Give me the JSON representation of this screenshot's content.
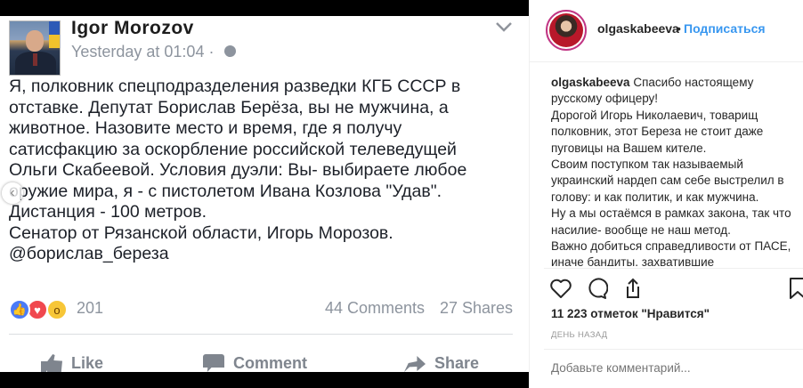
{
  "post_image": {
    "author": "Igor  Morozov",
    "timestamp": "Yesterday at 01:04 · ",
    "body": "Я, полковник спецподразделения разведки КГБ СССР в\nотставке. Депутат Борислав Берёза, вы не мужчина, а\nживотное. Назовите место и время, где я получу\nсатисфакцию за оскорбление российской телеведущей\nОльги Скабеевой. Условия дуэли: Вы- выбираете любое\nоружие мира, я - с пистолетом Ивана Козлова \"Удав\".\nДистанция - 100 метров.\nСенатор от Рязанской области, Игорь Морозов.\n@борислав_береза",
    "reactions_count": "201",
    "comments": "44 Comments",
    "shares": "27 Shares",
    "actions": {
      "like": "Like",
      "comment": "Comment",
      "share": "Share"
    }
  },
  "instagram": {
    "username": "olgaskabeeva",
    "dot": "•",
    "follow_label": "Подписаться",
    "caption_user": "olgaskabeeva",
    "caption_text": " Спасибо настоящему русскому офицеру!\nДорогой Игорь Николаевич, товарищ полковник, этот Береза не стоит даже пуговицы на Вашем кителе.\nСвоим поступком так называемый украинский нардеп сам себе выстрелил в голову: и как политик, и как мужчина.\nНу а мы остаёмся в рамках закона, так что насилие- вообще не наш метод.\nВажно добиться справедливости от ПАСЕ, иначе бандиты, захватившие",
    "likes": "11 223 отметок \"Нравится\"",
    "date": "ДЕНЬ НАЗАД",
    "comment_placeholder": "Добавьте комментарий..."
  }
}
